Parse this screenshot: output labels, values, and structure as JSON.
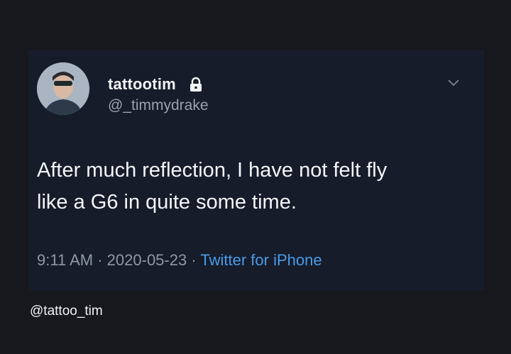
{
  "tweet": {
    "display_name": "tattootim",
    "handle": "@_timmydrake",
    "text_line1": "After much reflection, I have not felt fly",
    "text_line2": "like a G6 in quite some time.",
    "time": "9:11 AM",
    "separator": "·",
    "date": "2020-05-23",
    "source": "Twitter for iPhone",
    "icons": {
      "lock": "lock-icon",
      "menu": "chevron-down-icon"
    }
  },
  "watermark": "@tattoo_tim",
  "colors": {
    "background": "#17181d",
    "card": "#161c2a",
    "text": "#f4f5f7",
    "muted": "#8f98a3",
    "link": "#4a9be8"
  }
}
